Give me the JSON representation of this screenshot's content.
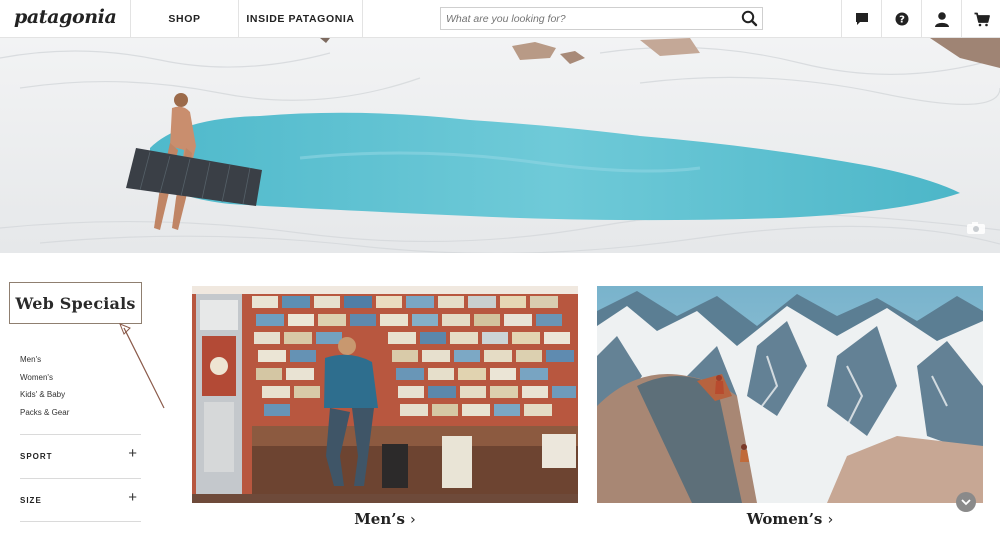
{
  "header": {
    "logo": "patagonia",
    "nav": [
      {
        "label": "SHOP"
      },
      {
        "label": "INSIDE PATAGONIA"
      }
    ],
    "search": {
      "placeholder": "What are you looking for?",
      "value": ""
    },
    "icons": [
      "chat-icon",
      "help-icon",
      "account-icon",
      "cart-icon"
    ]
  },
  "sidebar": {
    "title": "Web Specials",
    "links": [
      "Men's",
      "Women's",
      "Kids' & Baby",
      "Packs & Gear"
    ],
    "filters": [
      {
        "label": "SPORT",
        "toggle": "+"
      },
      {
        "label": "SIZE",
        "toggle": "+"
      }
    ]
  },
  "tiles": [
    {
      "label": "Men’s",
      "chevron": "›"
    },
    {
      "label": "Women’s",
      "chevron": "›"
    }
  ],
  "colors": {
    "snow": "#eef0f2",
    "water": "#5cc3d2",
    "accent_border": "#8f7f70"
  }
}
